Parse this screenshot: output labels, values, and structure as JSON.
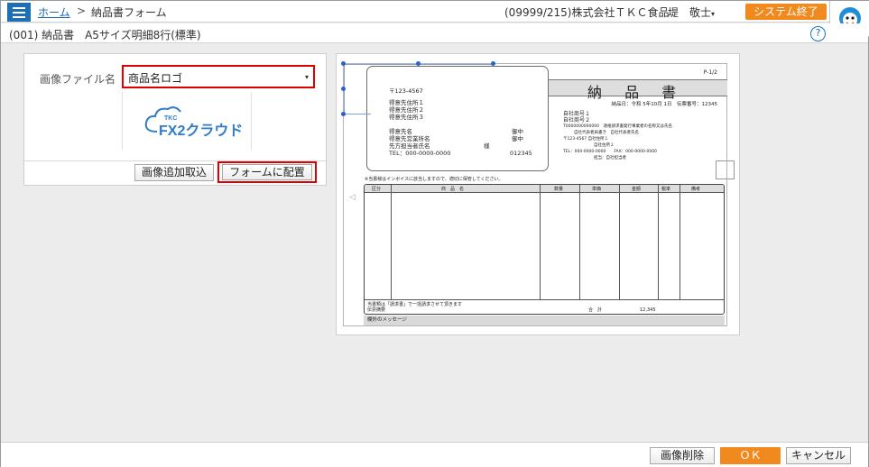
{
  "header": {
    "breadcrumb_home": "ホーム",
    "breadcrumb_separator": ">",
    "breadcrumb_current": "納品書フォーム",
    "company": "(09999/215)株式会社ＴＫＣ食品",
    "user": "堤　敬士",
    "user_caret": "▾",
    "system_exit": "システム終了",
    "accent_color": "#f08a1e",
    "brand_color": "#1e6fb6"
  },
  "subheader": {
    "title": "(001) 納品書　A5サイズ明細8行(標準)",
    "help": "?"
  },
  "image_panel": {
    "label": "画像ファイル名",
    "selected": "商品名ロゴ",
    "select_caret": "▾",
    "preview_top": "TKC",
    "preview_main": "FX2クラウド",
    "add_button": "画像追加取込",
    "place_button": "フォームに配置"
  },
  "form_preview": {
    "page_no": "P-1/2",
    "title": "納 品 書",
    "dateline": "納品日：令和 5年10月 1日　伝票番号：12345",
    "popup": {
      "postal": "〒123-4567",
      "addr1": "得意先住所１",
      "addr2": "得意先住所２",
      "addr3": "得意先住所３",
      "customer": "得意先名",
      "branch": "得意先営業所名",
      "contact": "先方担当者氏名",
      "onchu1": "御中",
      "onchu2": "御中",
      "sama": "様",
      "tel": "TEL：000-0000-0000",
      "code": "012345"
    },
    "company_block": {
      "name1": "自社商号１",
      "name2": "自社商号２",
      "regno": "T0000000000000　適格請求書発行事業者の名称又は氏名",
      "rep": "自社代表者肩書き　自社代表者氏名",
      "postal_addr": "〒123-4567 自社住所１",
      "addr2": "自社住所２",
      "tel_fax": "TEL：000-0000-0000　　FAX：000-0000-0000",
      "staff": "担当：自社担当者"
    },
    "notice": "※当書様はインボイスに該当しますので、適切に保管してください。",
    "columns": [
      "区分",
      "商　品　名",
      "数量",
      "単価",
      "金額",
      "税率",
      "備考"
    ],
    "foot_line1": "当書類は「請求書」で一括請求させて頂きます",
    "foot_line2": "伝票摘要",
    "total_label": "合　計",
    "total_value": "12,345",
    "message": "欄外のメッセージ",
    "left_arrow": "◁"
  },
  "footer": {
    "delete_button": "画像削除",
    "ok_button": "ＯＫ",
    "cancel_button": "キャンセル"
  }
}
